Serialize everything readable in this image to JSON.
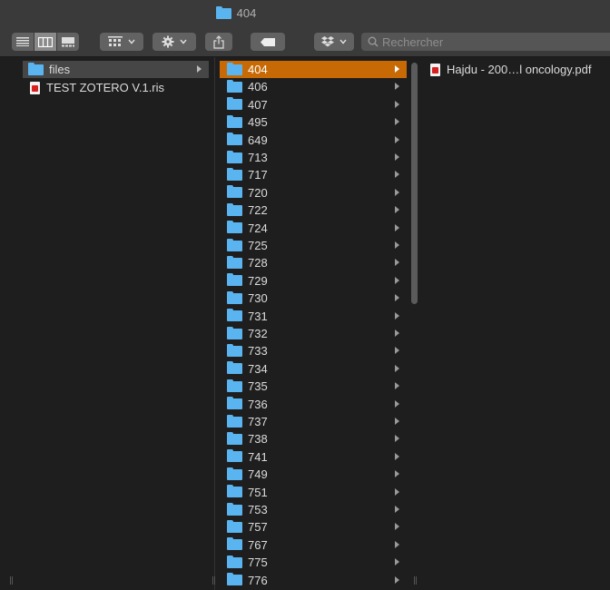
{
  "window": {
    "title": "404"
  },
  "toolbar": {
    "view_list_icon": "list-view-icon",
    "view_column_icon": "column-view-icon",
    "view_gallery_icon": "gallery-view-icon",
    "search": {
      "placeholder": "Rechercher"
    }
  },
  "column1": {
    "items": [
      {
        "label": "files",
        "type": "folder",
        "selected": true
      },
      {
        "label": "TEST ZOTERO V.1.ris",
        "type": "file"
      }
    ]
  },
  "column2": {
    "items": [
      {
        "label": "404",
        "selected": true
      },
      {
        "label": "406"
      },
      {
        "label": "407"
      },
      {
        "label": "495"
      },
      {
        "label": "649"
      },
      {
        "label": "713"
      },
      {
        "label": "717"
      },
      {
        "label": "720"
      },
      {
        "label": "722"
      },
      {
        "label": "724"
      },
      {
        "label": "725"
      },
      {
        "label": "728"
      },
      {
        "label": "729"
      },
      {
        "label": "730"
      },
      {
        "label": "731"
      },
      {
        "label": "732"
      },
      {
        "label": "733"
      },
      {
        "label": "734"
      },
      {
        "label": "735"
      },
      {
        "label": "736"
      },
      {
        "label": "737"
      },
      {
        "label": "738"
      },
      {
        "label": "741"
      },
      {
        "label": "749"
      },
      {
        "label": "751"
      },
      {
        "label": "753"
      },
      {
        "label": "757"
      },
      {
        "label": "767"
      },
      {
        "label": "775"
      },
      {
        "label": "776"
      }
    ]
  },
  "column3": {
    "items": [
      {
        "label": "Hajdu - 200…l oncology.pdf",
        "type": "pdf"
      }
    ]
  }
}
